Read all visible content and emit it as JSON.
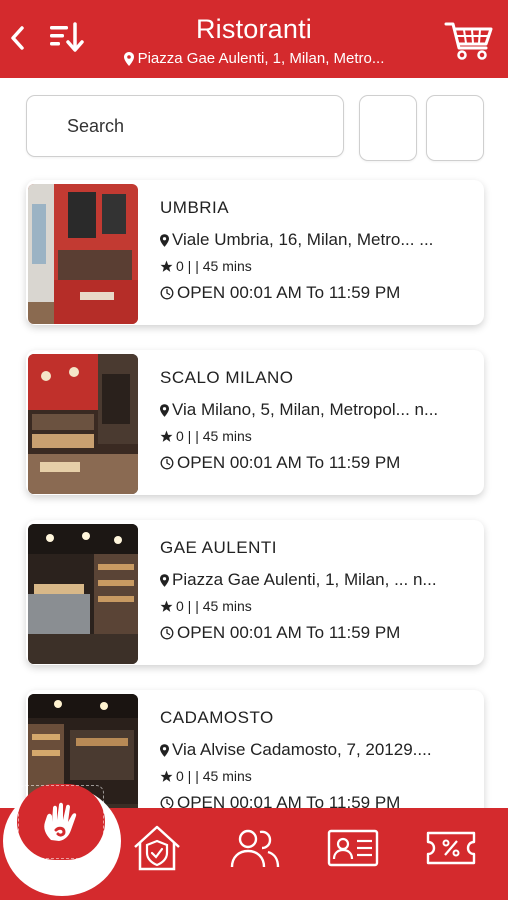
{
  "header": {
    "title": "Ristoranti",
    "location": "Piazza Gae Aulenti, 1, Milan, Metro...",
    "icons": [
      "back-arrow-icon",
      "sort-icon",
      "cart-icon",
      "location-pin-icon"
    ]
  },
  "search": {
    "placeholder": "Search"
  },
  "restaurants": [
    {
      "name": "UMBRIA",
      "address": "Viale Umbria, 16, Milan, Metro... ...",
      "rating": "0 | | 45 mins",
      "hours": "OPEN 00:01 AM To 11:59 PM"
    },
    {
      "name": "SCALO MILANO",
      "address": "Via Milano, 5, Milan, Metropol... n...",
      "rating": "0 | | 45 mins",
      "hours": "OPEN 00:01 AM To 11:59 PM"
    },
    {
      "name": "GAE AULENTI",
      "address": "Piazza Gae Aulenti, 1, Milan, ... n...",
      "rating": "0 | | 45 mins",
      "hours": "OPEN 00:01 AM To 11:59 PM"
    },
    {
      "name": "CADAMOSTO",
      "address": "Via Alvise Cadamosto, 7, 20129....",
      "rating": "0 | | 45 mins",
      "hours": "OPEN 00:01 AM To 11:59 PM"
    }
  ],
  "bottom_nav": [
    "hand-icon",
    "home-shield-icon",
    "users-icon",
    "id-card-icon",
    "discount-ticket-icon"
  ],
  "colors": {
    "primary": "#d42a2d",
    "background": "#ffffff",
    "text": "#222222",
    "border": "#cfcfcf"
  }
}
